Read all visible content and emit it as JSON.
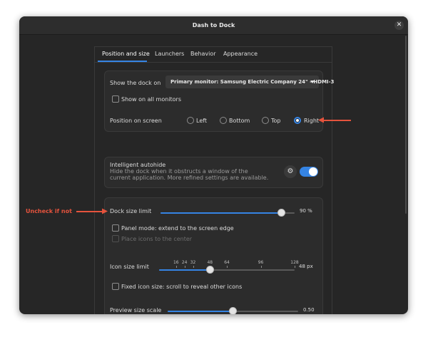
{
  "window": {
    "title": "Dash to Dock"
  },
  "tabs": [
    {
      "label": "Position and size",
      "active": true
    },
    {
      "label": "Launchers",
      "active": false
    },
    {
      "label": "Behavior",
      "active": false
    },
    {
      "label": "Appearance",
      "active": false
    }
  ],
  "position_card": {
    "show_dock_label": "Show the dock on",
    "monitor_value": "Primary monitor: Samsung Electric Company 24\" - HDMI-3",
    "all_monitors_label": "Show on all monitors",
    "all_monitors_checked": false,
    "position_label": "Position on screen",
    "positions": [
      "Left",
      "Bottom",
      "Top",
      "Right"
    ],
    "selected_position": "Right"
  },
  "autohide_card": {
    "title": "Intelligent autohide",
    "desc_line1": "Hide the dock when it obstructs a window of the",
    "desc_line2": "current application. More refined settings are available.",
    "enabled": true
  },
  "size_card": {
    "dock_size_label": "Dock size limit",
    "dock_size_value": "90 %",
    "dock_size_fraction": 0.9,
    "panel_mode_label": "Panel mode: extend to the screen edge",
    "panel_mode_checked": false,
    "place_center_label": "Place icons to the center",
    "icon_size_label": "Icon size limit",
    "icon_size_ticks": [
      "16",
      "24",
      "32",
      "48",
      "64",
      "96",
      "128"
    ],
    "icon_size_value": "48 px",
    "icon_size_selected": 48,
    "fixed_icon_label": "Fixed icon size: scroll to reveal other icons",
    "preview_label": "Preview size scale",
    "preview_value": "0.50",
    "preview_fraction": 0.5
  },
  "annotations": {
    "uncheck_text": "Uncheck if not",
    "arrow_color": "#e5533d"
  },
  "colors": {
    "accent": "#3584e4",
    "window_bg": "#262626",
    "card_bg": "#2c2c2c"
  }
}
